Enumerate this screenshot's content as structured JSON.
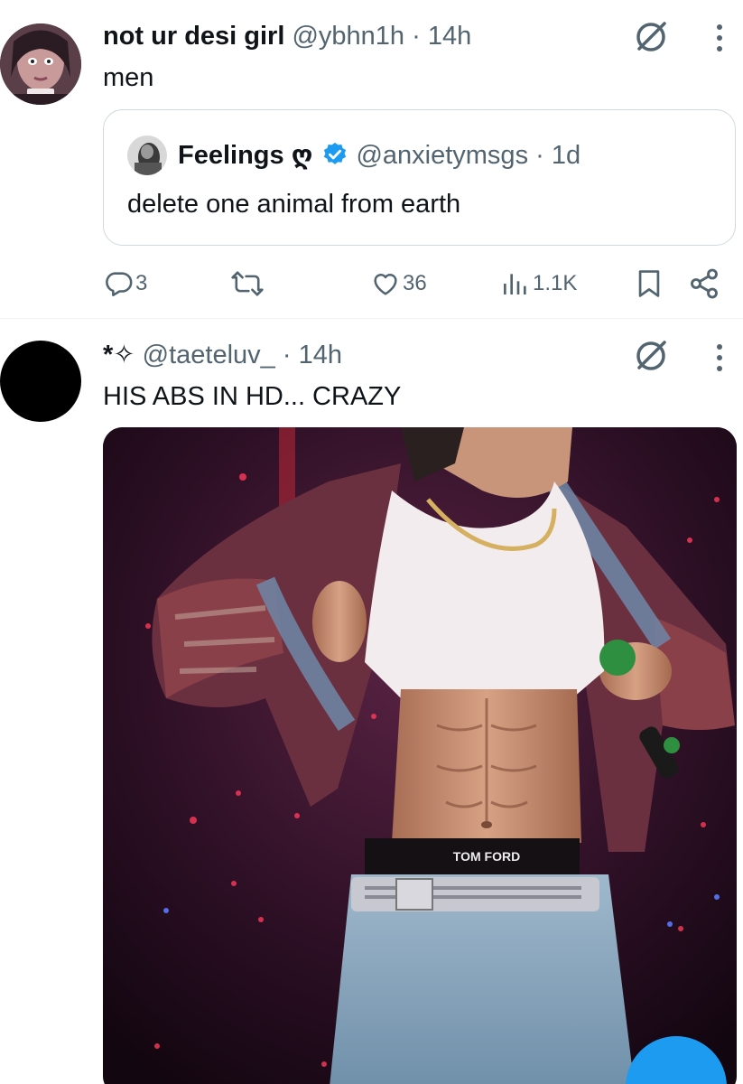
{
  "tweet1": {
    "display_name": "not ur desi girl",
    "handle": "@ybhn1h",
    "time": "· 14h",
    "text": "men",
    "quote": {
      "display_name": "Feelings ღ",
      "handle": "@anxietymsgs",
      "time": "· 1d",
      "text": "delete one animal from earth",
      "verified": true
    },
    "actions": {
      "replies": "3",
      "retweets": "",
      "likes": "36",
      "views": "1.1K"
    }
  },
  "tweet2": {
    "display_name": "*✧",
    "handle": "@taeteluv_",
    "time": "· 14h",
    "text": "HIS ABS IN HD... CRAZY",
    "image_text": "TOM FORD"
  },
  "colors": {
    "text": "#0f1419",
    "secondary": "#536471",
    "verified": "#1d9bf0",
    "border": "#cfd9de",
    "fab": "#1d9bf0"
  },
  "icons": [
    "grok-icon",
    "more-icon",
    "reply-icon",
    "retweet-icon",
    "like-icon",
    "views-icon",
    "bookmark-icon",
    "share-icon",
    "verified-badge-icon"
  ]
}
